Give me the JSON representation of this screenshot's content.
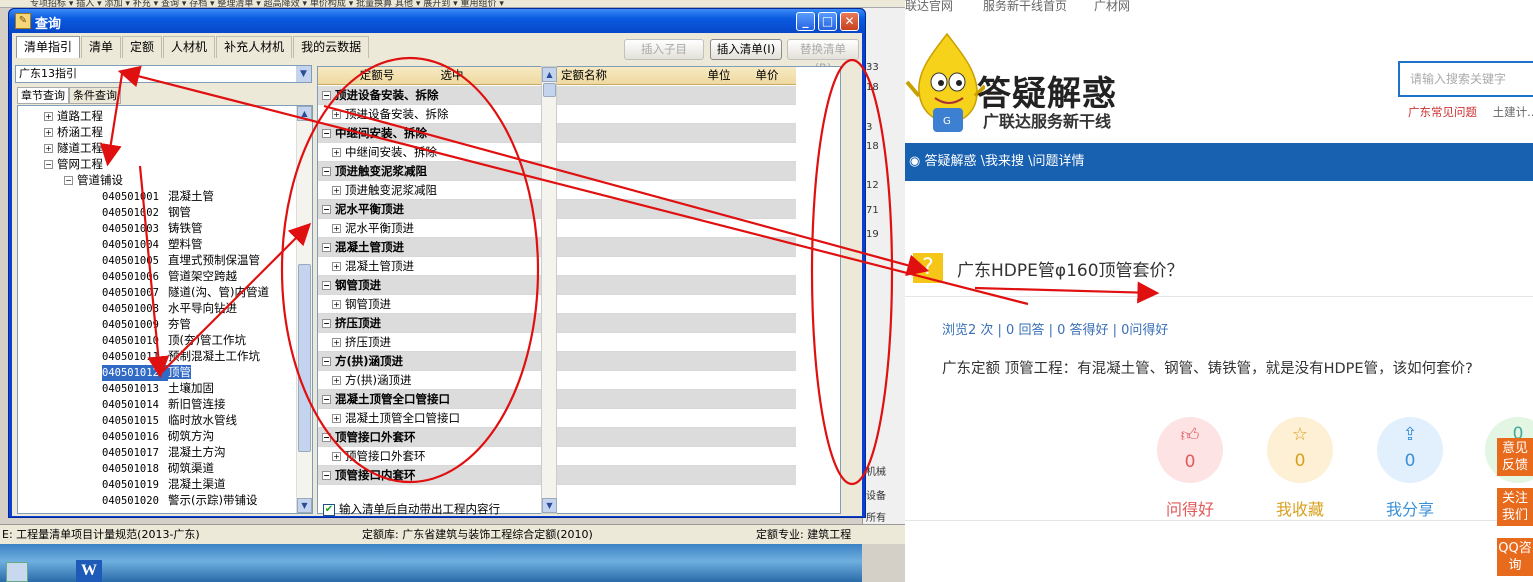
{
  "bg_app": {
    "top_menu": "专项招标 ▾  插入 ▾  添加 ▾  补充 ▾  查询 ▾  存档 ▾    整理清单 ▾  超高降效 ▾  单价构成 ▾  批量换算  其他 ▾  展开到 ▾  重用组价 ▾",
    "right_numbers": [
      "33",
      "18",
      "3",
      "18",
      "12",
      "71",
      "19"
    ],
    "right_labels": [
      "机械",
      "设备",
      "所有"
    ],
    "status": {
      "left": "E: 工程量清单项目计量规范(2013-广东)",
      "mid": "定额库: 广东省建筑与装饰工程综合定额(2010)",
      "right": "定额专业: 建筑工程"
    },
    "desktop_word_letter": "W"
  },
  "dialog": {
    "title": "查询",
    "tabs": [
      "清单指引",
      "清单",
      "定额",
      "人材机",
      "补充人材机",
      "我的云数据"
    ],
    "active_tab": 0,
    "buttons": {
      "insert_child": "插入子目",
      "insert_list": "插入清单(I)",
      "replace_list": "替换清单(R)"
    },
    "combo_value": "广东13指引",
    "subtabs": [
      "章节查询",
      "条件查询"
    ],
    "tree": {
      "nodes": [
        {
          "label": "道路工程",
          "level": 1,
          "toggle": "+"
        },
        {
          "label": "桥涵工程",
          "level": 1,
          "toggle": "+"
        },
        {
          "label": "隧道工程",
          "level": 1,
          "toggle": "+"
        },
        {
          "label": "管网工程",
          "level": 1,
          "toggle": "−"
        },
        {
          "label": "管道铺设",
          "level": 2,
          "toggle": "−"
        }
      ],
      "items": [
        {
          "code": "040501001",
          "name": "混凝土管"
        },
        {
          "code": "040501002",
          "name": "钢管"
        },
        {
          "code": "040501003",
          "name": "铸铁管"
        },
        {
          "code": "040501004",
          "name": "塑料管"
        },
        {
          "code": "040501005",
          "name": "直埋式预制保温管"
        },
        {
          "code": "040501006",
          "name": "管道架空跨越"
        },
        {
          "code": "040501007",
          "name": "隧道(沟、管)内管道"
        },
        {
          "code": "040501008",
          "name": "水平导向钻进"
        },
        {
          "code": "040501009",
          "name": "夯管"
        },
        {
          "code": "040501010",
          "name": "顶(夯)管工作坑"
        },
        {
          "code": "040501011",
          "name": "预制混凝土工作坑"
        },
        {
          "code": "040501012",
          "name": "顶管"
        },
        {
          "code": "040501013",
          "name": "土壤加固"
        },
        {
          "code": "040501014",
          "name": "新旧管连接"
        },
        {
          "code": "040501015",
          "name": "临时放水管线"
        },
        {
          "code": "040501016",
          "name": "砌筑方沟"
        },
        {
          "code": "040501017",
          "name": "混凝土方沟"
        },
        {
          "code": "040501018",
          "name": "砌筑渠道"
        },
        {
          "code": "040501019",
          "name": "混凝土渠道"
        },
        {
          "code": "040501020",
          "name": "警示(示踪)带铺设"
        }
      ],
      "selected_index": 11
    },
    "grid": {
      "headers": [
        "定额号",
        "选中",
        "定额名称",
        "单位",
        "单价"
      ],
      "rows": [
        {
          "label": "顶进设备安装、拆除",
          "group": true
        },
        {
          "label": "顶进设备安装、拆除",
          "group": false
        },
        {
          "label": "中继间安装、拆除",
          "group": true
        },
        {
          "label": "中继间安装、拆除",
          "group": false
        },
        {
          "label": "顶进触变泥浆减阻",
          "group": true
        },
        {
          "label": "顶进触变泥浆减阻",
          "group": false
        },
        {
          "label": "泥水平衡顶进",
          "group": true
        },
        {
          "label": "泥水平衡顶进",
          "group": false
        },
        {
          "label": "混凝土管顶进",
          "group": true
        },
        {
          "label": "混凝土管顶进",
          "group": false
        },
        {
          "label": "钢管顶进",
          "group": true
        },
        {
          "label": "钢管顶进",
          "group": false
        },
        {
          "label": "挤压顶进",
          "group": true
        },
        {
          "label": "挤压顶进",
          "group": false
        },
        {
          "label": "方(拱)涵顶进",
          "group": true
        },
        {
          "label": "方(拱)涵顶进",
          "group": false
        },
        {
          "label": "混凝土顶管全口管接口",
          "group": true
        },
        {
          "label": "混凝土顶管全口管接口",
          "group": false
        },
        {
          "label": "顶管接口外套环",
          "group": true
        },
        {
          "label": "顶管接口外套环",
          "group": false
        },
        {
          "label": "顶管接口内套环",
          "group": true
        }
      ]
    },
    "checkbox_label": "输入清单后自动带出工程内容行",
    "checkbox_checked": true
  },
  "web": {
    "top_links": [
      "联达官网",
      "服务新干线首页",
      "广材网"
    ],
    "brand": "答疑解惑",
    "brand_sub": "广联达服务新干线",
    "search_placeholder": "请输入搜索关键字",
    "hot_links": [
      "广东常见问题",
      "土建计..."
    ],
    "breadcrumb": "答疑解惑 \\我来搜 \\问题详情",
    "question_title": "广东HDPE管φ160顶管套价？",
    "stats": "浏览2 次 | 0 回答 | 0 答得好 | 0问得好",
    "question_body": "广东定额 顶管工程：有混凝土管、钢管、铸铁管，就是没有HDPE管，该如何套价?",
    "actions": [
      {
        "label": "问得好",
        "count": "0",
        "color": "#e05a5a",
        "bg": "#fde3e3"
      },
      {
        "label": "我收藏",
        "count": "0",
        "color": "#d9a020",
        "bg": "#fdf0d5"
      },
      {
        "label": "我分享",
        "count": "0",
        "color": "#3a90d8",
        "bg": "#e1f0fc"
      }
    ],
    "fourth_action_count": "0",
    "side_buttons": [
      "意见反馈",
      "关注我们",
      "QQ咨询"
    ]
  },
  "colors": {
    "annotation_red": "#e01010",
    "dialog_blue": "#0a5ae0",
    "nav_blue": "#1860b0",
    "selection": "#316ac5"
  }
}
